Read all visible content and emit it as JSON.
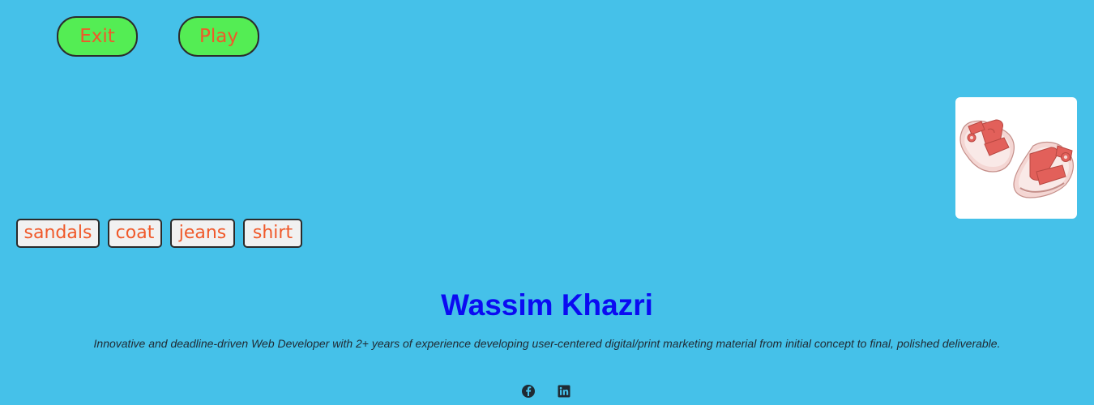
{
  "controls": {
    "exit_label": "Exit",
    "play_label": "Play"
  },
  "product": {
    "image_icon": "sandals-illustration"
  },
  "choices": [
    {
      "label": "sandals"
    },
    {
      "label": "coat"
    },
    {
      "label": "jeans"
    },
    {
      "label": "shirt"
    }
  ],
  "profile": {
    "name": "Wassim Khazri",
    "bio": "Innovative and deadline-driven Web Developer with 2+ years of experience developing user-centered digital/print marketing material from initial concept to final, polished deliverable."
  },
  "social": [
    {
      "icon": "facebook-icon"
    },
    {
      "icon": "linkedin-icon"
    }
  ],
  "colors": {
    "background": "#45c1e9",
    "button_fill": "#54ed54",
    "button_text": "#f0592a",
    "name_text": "#0b0bf2",
    "sandal_red": "#e2605a"
  }
}
